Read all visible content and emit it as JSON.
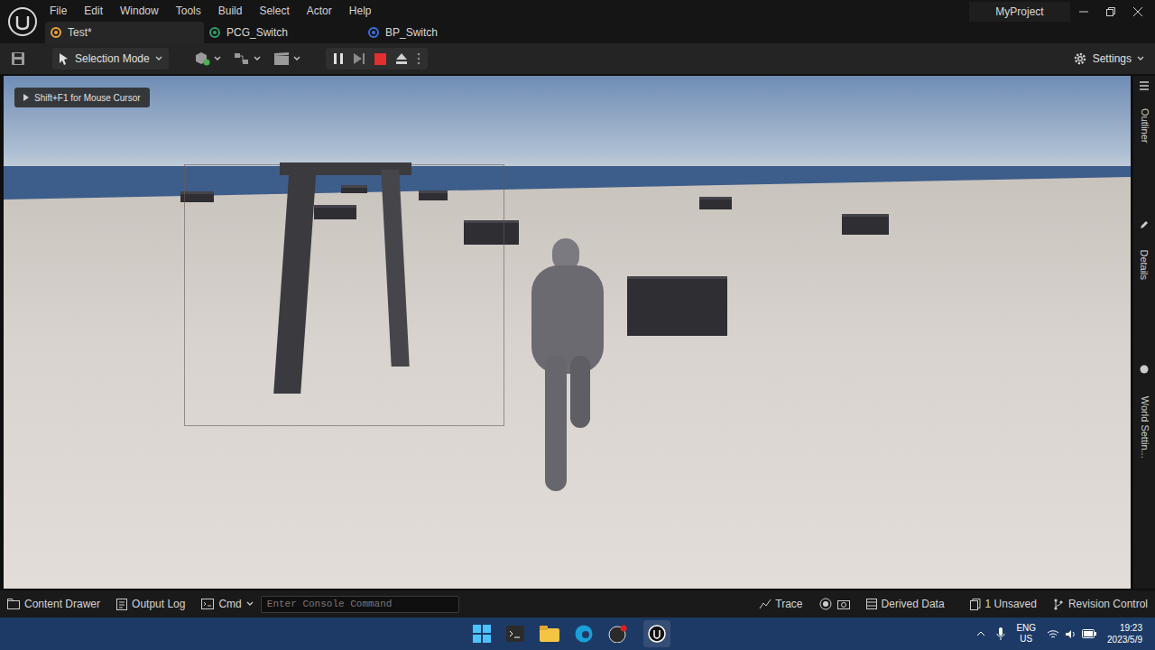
{
  "app": {
    "project": "MyProject"
  },
  "menu": [
    "File",
    "Edit",
    "Window",
    "Tools",
    "Build",
    "Select",
    "Actor",
    "Help"
  ],
  "tabs": [
    {
      "label": "Test*",
      "selected": true,
      "color": "#e8a23a"
    },
    {
      "label": "PCG_Switch",
      "selected": false,
      "color": "#27a06b"
    },
    {
      "label": "BP_Switch",
      "selected": false,
      "color": "#3a6fd8"
    }
  ],
  "toolbar": {
    "mode": "Selection Mode",
    "settings": "Settings",
    "playing": true
  },
  "viewport": {
    "hint": "Shift+F1 for Mouse Cursor"
  },
  "side_panels": [
    "Outliner",
    "Details",
    "World Settin..."
  ],
  "status_bar": {
    "content_drawer": "Content Drawer",
    "output_log": "Output Log",
    "cmd": "Cmd",
    "console_placeholder": "Enter Console Command",
    "trace": "Trace",
    "derived_data": "Derived Data",
    "unsaved": "1 Unsaved",
    "revision_control": "Revision Control"
  },
  "taskbar": {
    "lang1": "ENG",
    "lang2": "US",
    "time": "19:23",
    "date": "2023/5/9"
  }
}
